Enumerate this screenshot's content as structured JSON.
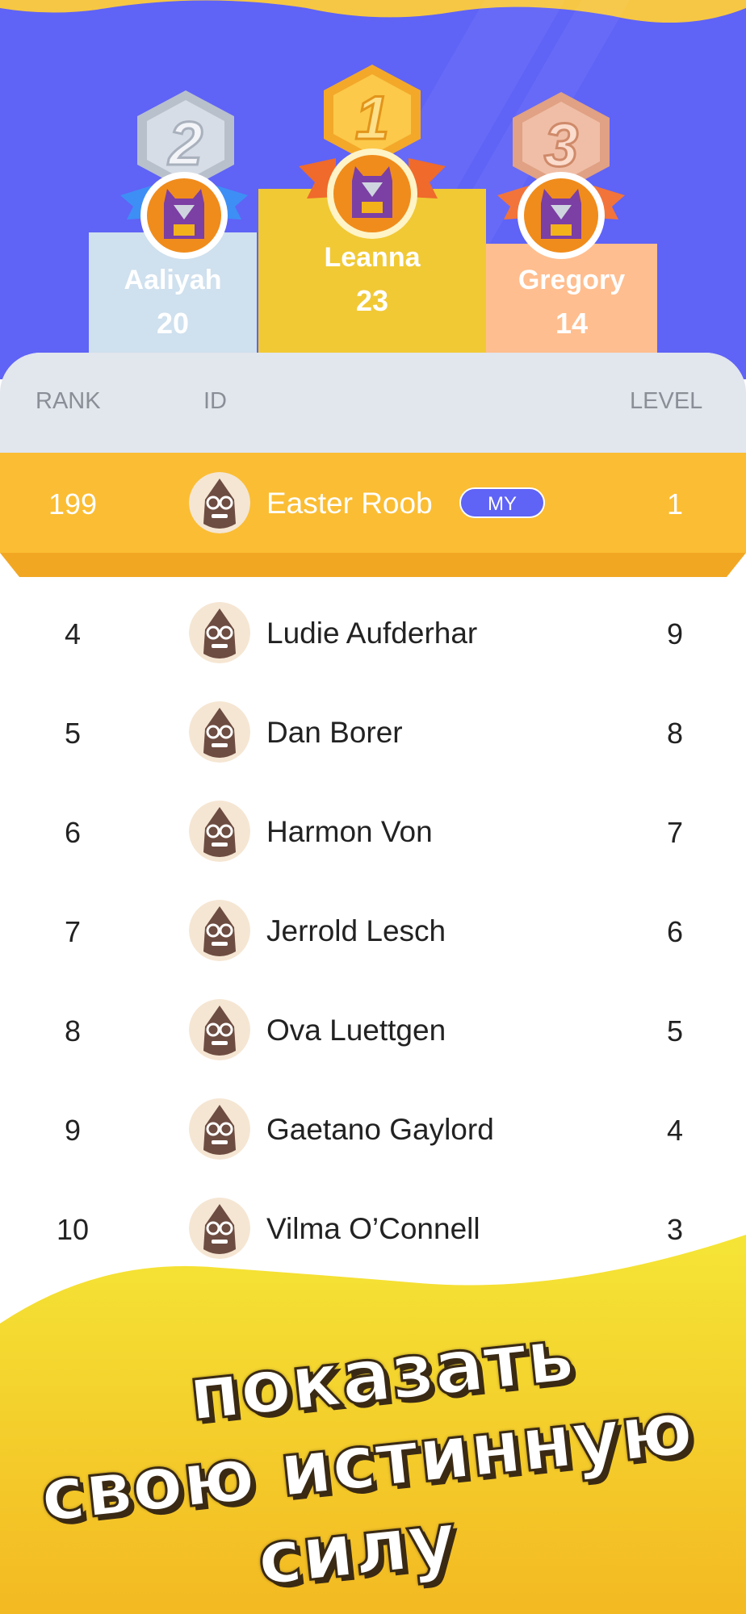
{
  "podium": [
    {
      "place": 2,
      "name": "Aaliyah",
      "score": "20"
    },
    {
      "place": 1,
      "name": "Leanna",
      "score": "23"
    },
    {
      "place": 3,
      "name": "Gregory",
      "score": "14"
    }
  ],
  "table_header": {
    "rank": "RANK",
    "id": "ID",
    "level": "LEVEL"
  },
  "my_row": {
    "rank": "199",
    "name": "Easter Roob",
    "badge": "MY",
    "level": "1"
  },
  "rows": [
    {
      "rank": "4",
      "name": "Ludie Aufderhar",
      "level": "9"
    },
    {
      "rank": "5",
      "name": "Dan Borer",
      "level": "8"
    },
    {
      "rank": "6",
      "name": "Harmon Von",
      "level": "7"
    },
    {
      "rank": "7",
      "name": "Jerrold Lesch",
      "level": "6"
    },
    {
      "rank": "8",
      "name": "Ova Luettgen",
      "level": "5"
    },
    {
      "rank": "9",
      "name": "Gaetano Gaylord",
      "level": "4"
    },
    {
      "rank": "10",
      "name": "Vilma O’Connell",
      "level": "3"
    }
  ],
  "banner": {
    "line1": "показать",
    "line2": "свою истинную",
    "line3": "силу"
  },
  "colors": {
    "primary": "#5f63f6",
    "gold": "#f1c935",
    "silver": "#cfe0ee",
    "bronze": "#ffbe8f",
    "highlight": "#fbbd33"
  }
}
